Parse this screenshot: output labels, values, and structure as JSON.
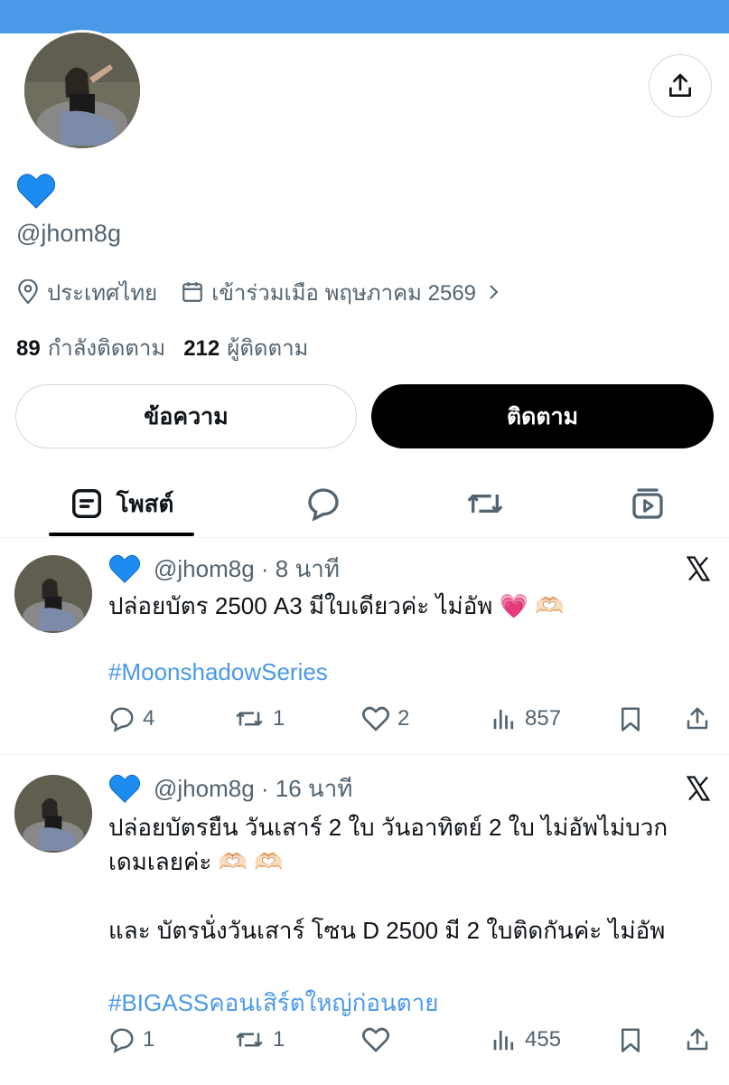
{
  "profile": {
    "emoji": "💙",
    "handle": "@jhom8g",
    "location": "ประเทศไทย",
    "joined": "เข้าร่วมเมือ พฤษภาคม 2569",
    "following_count": "89",
    "following_label": "กำลังติดตาม",
    "followers_count": "212",
    "followers_label": "ผู้ติดตาม"
  },
  "buttons": {
    "message": "ข้อความ",
    "follow": "ติดตาม"
  },
  "tabs": {
    "posts": "โพสต์"
  },
  "posts": [
    {
      "handle_time": "@jhom8g · 8 นาที",
      "text": "ปล่อยบัตร 2500 A3 มีใบเดียวค่ะ ไม่อัพ 💗 🫶🏻",
      "hashtag": "#MoonshadowSeries",
      "replies": "4",
      "reposts": "1",
      "likes": "2",
      "views": "857"
    },
    {
      "handle_time": "@jhom8g · 16 นาที",
      "text_line1": "ปล่อยบัตรยืน วันเสาร์ 2 ใบ วันอาทิตย์ 2 ใบ ไม่อัพไม่บวก",
      "text_line2": "เดมเลยค่ะ 🫶🏻 🫶🏻",
      "text_line3": "และ บัตรนั่งวันเสาร์ โซน D 2500 มี 2 ใบติดกันค่ะ ไม่อัพ",
      "hashtag": "#BIGASSคอนเสิร์ตใหญ่ก่อนตาย",
      "replies": "1",
      "reposts": "1",
      "likes": "",
      "views": "455"
    }
  ],
  "colors": {
    "banner": "#4a99e9",
    "link": "#4a99e9",
    "heart_blue": "#1d8cf0"
  }
}
